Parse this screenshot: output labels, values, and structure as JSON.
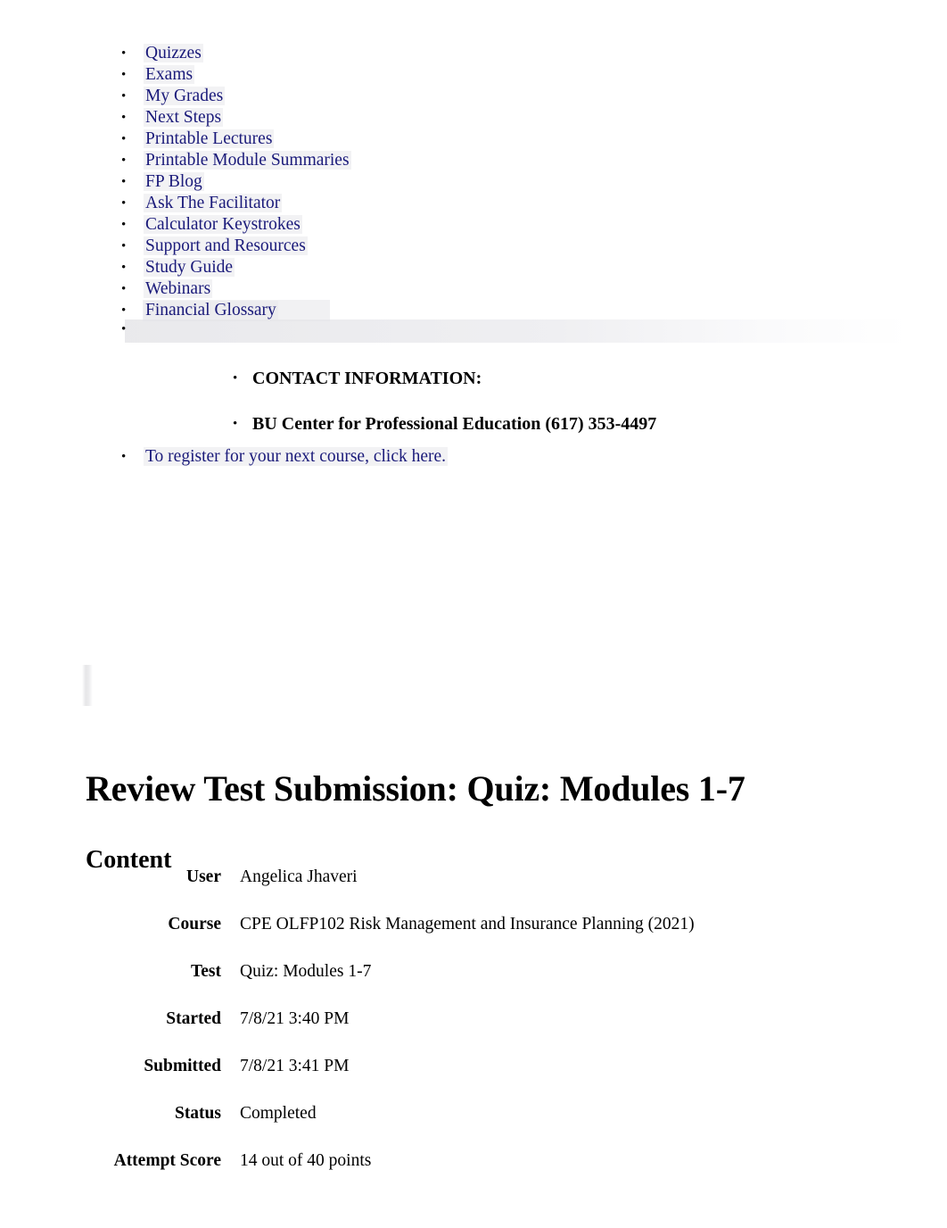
{
  "nav": {
    "items": [
      {
        "label": "Quizzes"
      },
      {
        "label": "Exams"
      },
      {
        "label": "My Grades"
      },
      {
        "label": "Next Steps"
      },
      {
        "label": "Printable Lectures"
      },
      {
        "label": "Printable Module Summaries"
      },
      {
        "label": "FP Blog"
      },
      {
        "label": "Ask The Facilitator"
      },
      {
        "label": "Calculator Keystrokes"
      },
      {
        "label": "Support and Resources"
      },
      {
        "label": "Study Guide"
      },
      {
        "label": "Webinars"
      },
      {
        "label": "Financial Glossary"
      },
      {
        "label": ""
      }
    ]
  },
  "contact": {
    "heading": "CONTACT INFORMATION:",
    "line": "BU Center for Professional Education (617) 353-4497",
    "register_link": "To register for your next course, click here."
  },
  "document": {
    "title": "Review Test Submission: Quiz: Modules 1-7",
    "section_heading": "Content",
    "rows": [
      {
        "label": "User",
        "value": "Angelica Jhaveri"
      },
      {
        "label": "Course",
        "value": "CPE OLFP102 Risk Management and Insurance Planning (2021)"
      },
      {
        "label": "Test",
        "value": "Quiz: Modules 1-7"
      },
      {
        "label": "Started",
        "value": "7/8/21 3:40 PM"
      },
      {
        "label": "Submitted",
        "value": "7/8/21 3:41 PM"
      },
      {
        "label": "Status",
        "value": "Completed"
      },
      {
        "label": "Attempt Score",
        "value": "14 out of 40 points"
      }
    ]
  },
  "colors": {
    "link": "#1a1a7a",
    "text": "#000000",
    "background": "#ffffff",
    "wash": "#e8e8ec"
  }
}
